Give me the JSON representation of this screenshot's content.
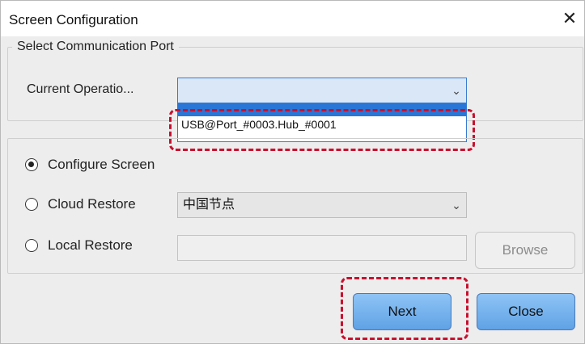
{
  "window": {
    "title": "Screen Configuration",
    "close_glyph": "✕"
  },
  "communication": {
    "legend": "Select Communication Port",
    "operation_label": "Current Operatio...",
    "operation_value": "",
    "dropdown_items": [
      "USB@Port_#0003.Hub_#0001"
    ]
  },
  "options": {
    "configure_label": "Configure Screen",
    "cloud_label": "Cloud Restore",
    "local_label": "Local Restore",
    "selected": "configure",
    "cloud_value": "中国节点",
    "local_path": ""
  },
  "buttons": {
    "browse": "Browse",
    "next": "Next",
    "close": "Close"
  },
  "icons": {
    "chevron": "chevron-down-icon",
    "close": "close-icon"
  },
  "colors": {
    "highlight": "#c8102e",
    "primary_button": "#6aaeea",
    "dropdown_accent": "#2a76d6"
  }
}
